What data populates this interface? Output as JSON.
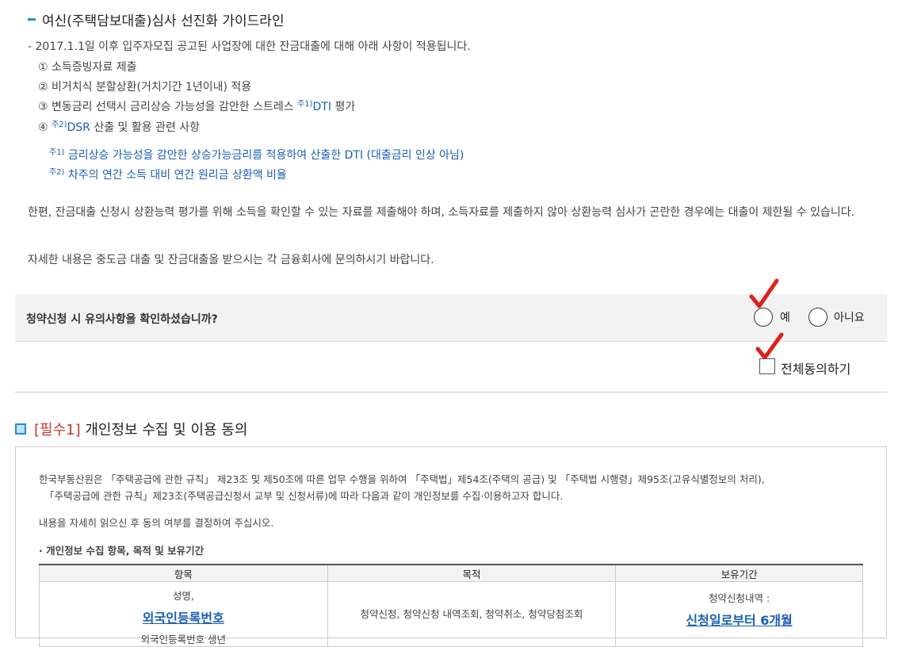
{
  "guide": {
    "title": "여신(주택담보대출)심사 선진화 가이드라인",
    "intro": "-  2017.1.1일 이후 입주자모집 공고된 사업장에 대한 잔금대출에 대해 아래 사항이 적용됩니다.",
    "items": [
      "① 소득증빙자료 제출",
      "② 비거치식 분할상환(거치기간 1년이내) 적용",
      "③ 변동금리 선택시 금리상승 가능성을 감안한 스트레스 ",
      "④ "
    ],
    "item3_sup": "주1)",
    "item3_link": "DTI",
    "item3_tail": " 평가",
    "item4_sup": "주2)",
    "item4_link": "DSR",
    "item4_tail": " 산출 및 활용 관련 사항",
    "note1_sup": "주1)",
    "note1": " 금리상승 가능성을 감안한 상승가능금리를 적용하여 산출한 DTI (대출금리 인상 아님)",
    "note2_sup": "주2)",
    "note2": " 차주의 연간 소득 대비 연간 원리금 상환액 비율",
    "para1": "한편, 잔금대출 신청시 상환능력 평가를 위해 소득을 확인할 수 있는 자료를 제출해야 하며, 소득자료를 제출하지 않아 상환능력 심사가 곤란한 경우에는 대출이 제한될 수 있습니다.",
    "para2": "자세한 내용은 중도금 대출 및 잔금대출을 받으시는 각 금융회사에 문의하시기 바랍니다."
  },
  "question": {
    "text": "청약신청 시 유의사항을 확인하셨습니까?",
    "yes_label": "예",
    "no_label": "아니요"
  },
  "agree_all_label": "전체동의하기",
  "required1": {
    "tag": "[필수1]",
    "title": "개인정보 수집 및 이용 동의",
    "desc1": "한국부동산원은 「주택공급에 관한 규칙」 제23조 및 제50조에 따른 업무 수행을 위하여 「주택법」제54조(주택의 공급) 및 「주택법 시행령」제95조(고유식별정보의 처리),",
    "desc2": "「주택공급에 관한 규칙」제23조(주택공급신청서 교부 및 신청서류)에 따라 다음과 같이 개인정보를 수집·이용하고자 합니다.",
    "desc3": "내용을 자세히 읽으신 후 동의 여부를 결정하여 주십시오.",
    "subheading": "· 개인정보 수집 항목, 목적 및 보유기간",
    "table": {
      "headers": [
        "항목",
        "목적",
        "보유기간"
      ],
      "col1_line1": "성명,",
      "col1_link": "외국인등록번호",
      "col1_line3": "외국인등록번호 생년",
      "col2": "청약신청, 청약신청 내역조회, 청약취소, 청약당첨조회",
      "col3_line1": "청약신청내역 :",
      "col3_link": "신청일로부터 6개월"
    }
  },
  "colors": {
    "accent_blue": "#1e8fd6",
    "link_blue": "#1a5fb4",
    "required_red": "#c0392b",
    "annotation_red": "#e0201a"
  }
}
